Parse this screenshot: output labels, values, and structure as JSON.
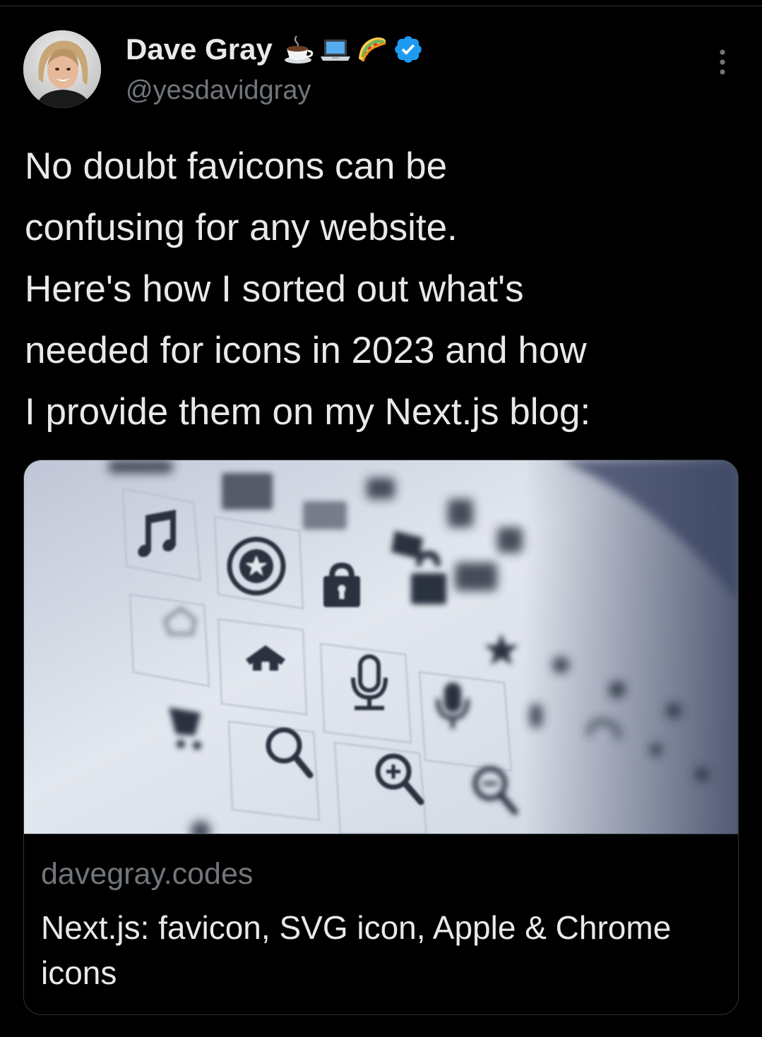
{
  "tweet": {
    "author": {
      "name": "Dave Gray",
      "handle": "@yesdavidgray",
      "name_emojis": [
        "coffee-emoji",
        "laptop-emoji",
        "taco-emoji"
      ],
      "verified": true,
      "verified_color": "#1d9bf0"
    },
    "text": "No doubt favicons can be\nconfusing for any website.\nHere's how I sorted out what's\nneeded for icons in 2023 and how\nI provide them on my Next.js blog:",
    "card": {
      "domain": "davegray.codes",
      "title": "Next.js: favicon, SVG icon, Apple & Chrome icons",
      "image_subject": "blurred grid of UI icons: music note, calendar, star badge, padlock, home, microphone, shopping cart, magnifier, zoom in, zoom out"
    }
  },
  "colors": {
    "background": "#000000",
    "text_primary": "#e7e9ea",
    "text_secondary": "#71767b",
    "border": "#2f3336"
  }
}
